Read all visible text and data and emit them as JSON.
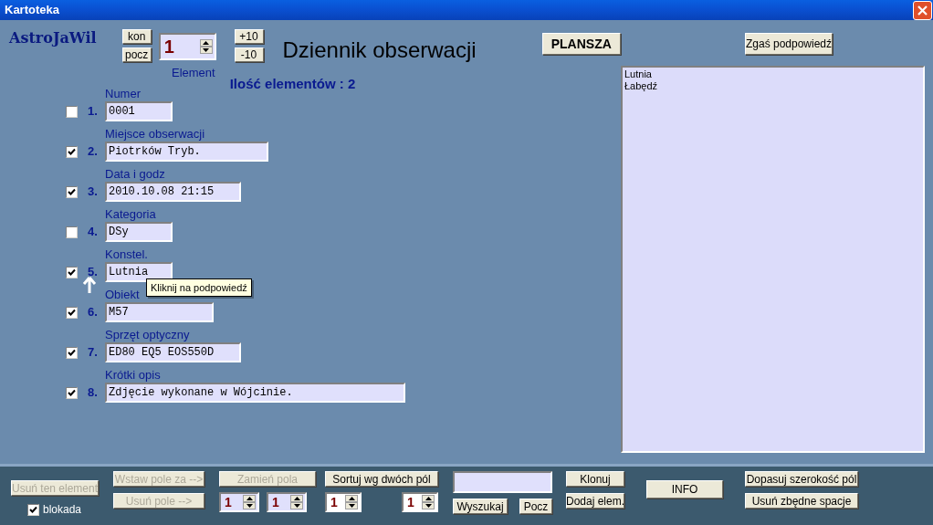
{
  "window": {
    "title": "Kartoteka"
  },
  "header": {
    "logo": "AstroJaWil",
    "nav_buttons": [
      "kon",
      "pocz"
    ],
    "element_spinner": {
      "value": "1"
    },
    "step_buttons": [
      "+10",
      "-10"
    ],
    "title": "Dziennik obserwacji",
    "element_label": "Element",
    "count": "Ilość elementów : 2",
    "plansza_button": "PLANSZA",
    "hint_button": "Zgaś podpowiedź"
  },
  "fields": [
    {
      "number": "1.",
      "label": "Numer",
      "value": "0001",
      "checked": false
    },
    {
      "number": "2.",
      "label": "Miejsce obserwacji",
      "value": "Piotrków Tryb.",
      "checked": true
    },
    {
      "number": "3.",
      "label": "Data i godz",
      "value": "2010.10.08 21:15",
      "checked": true
    },
    {
      "number": "4.",
      "label": "Kategoria",
      "value": "DSy",
      "checked": false
    },
    {
      "number": "5.",
      "label": "Konstel.",
      "value": "Lutnia",
      "checked": true
    },
    {
      "number": "6.",
      "label": "Obiekt",
      "value": "M57",
      "checked": true
    },
    {
      "number": "7.",
      "label": "Sprzęt optyczny",
      "value": "ED80 EQ5 EOS550D",
      "checked": true
    },
    {
      "number": "8.",
      "label": "Krótki opis",
      "value": "Zdjęcie wykonane w Wójcinie.",
      "checked": true
    }
  ],
  "tooltip": "Kliknij na podpowiedź",
  "hint_list": [
    "Lutnia",
    "Łabędź"
  ],
  "bottom": {
    "delete_element": {
      "label": "Usuń ten element",
      "disabled": true
    },
    "lock": {
      "label": "blokada",
      "checked": true
    },
    "insert_field": {
      "label": "Wstaw pole za -->",
      "disabled": true
    },
    "delete_field": {
      "label": "Usuń pole -->",
      "disabled": true
    },
    "swap_fields": {
      "label": "Zamień pola",
      "disabled": true
    },
    "sort": {
      "label": "Sortuj wg dwóch pól",
      "disabled": false
    },
    "spinners": [
      {
        "value": "1"
      },
      {
        "value": "1"
      },
      {
        "value": "1"
      },
      {
        "value": "1"
      }
    ],
    "search_button": "Wyszukaj",
    "start_button": "Pocz",
    "clone_button": "Klonuj",
    "add_button": "Dodaj elem.",
    "info_button": "INFO",
    "fit_button": "Dopasuj szerokość pól",
    "trim_button": "Usuń zbędne spacje"
  }
}
